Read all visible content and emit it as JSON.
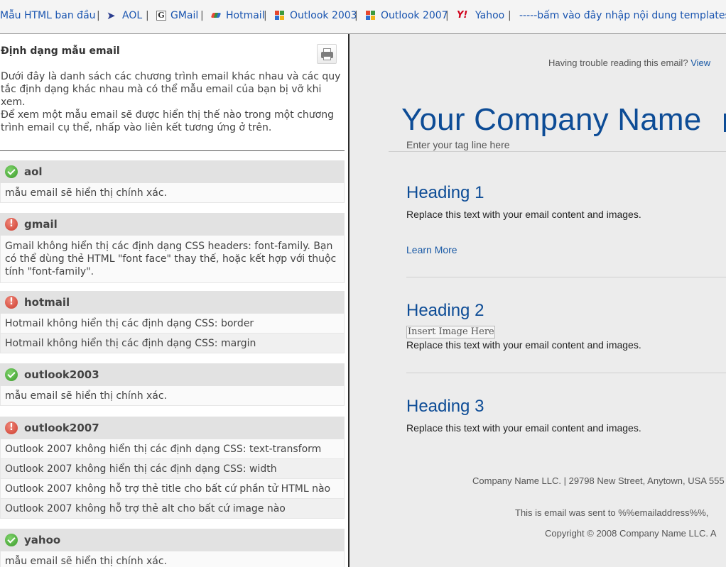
{
  "top_nav": {
    "items": [
      {
        "label": "Mẫu HTML ban đầu",
        "icon": null
      },
      {
        "label": "AOL",
        "icon": "aol-icon"
      },
      {
        "label": "GMail",
        "icon": "gmail-icon"
      },
      {
        "label": "Hotmail",
        "icon": "hotmail-icon"
      },
      {
        "label": "Outlook 2003",
        "icon": "outlook-2003-icon"
      },
      {
        "label": "Outlook 2007",
        "icon": "outlook-2007-icon"
      },
      {
        "label": "Yahoo",
        "icon": "yahoo-icon"
      },
      {
        "label": "-----bấm vào đây nhập nội dung templates n",
        "icon": null
      }
    ],
    "separator": "|"
  },
  "left_panel": {
    "title": "Định dạng mẫu email",
    "print_icon": "printer-icon",
    "description_1": "Dưới đây là danh sách các chương trình email khác nhau và các quy tắc định dạng khác nhau mà có thể mẫu email của bạn bị vỡ khi xem.",
    "description_2": "Để xem một mẫu email sẽ được hiển thị thế nào trong một chương trình email cụ thể, nhấp vào liên kết tương ứng ở trên.",
    "clients": [
      {
        "name": "aol",
        "status": "ok",
        "messages": [
          "mẫu email sẽ hiển thị chính xác."
        ]
      },
      {
        "name": "gmail",
        "status": "error",
        "messages": [
          "Gmail không hiển thị các định dạng CSS headers: font-family. Bạn có thể dùng thẻ HTML \"font face\" thay thế, hoặc kết hợp với thuộc tính \"font-family\"."
        ]
      },
      {
        "name": "hotmail",
        "status": "error",
        "messages": [
          "Hotmail không hiển thị các định dạng CSS: border",
          "Hotmail không hiển thị các định dạng CSS: margin"
        ]
      },
      {
        "name": "outlook2003",
        "status": "ok",
        "messages": [
          "mẫu email sẽ hiển thị chính xác."
        ]
      },
      {
        "name": "outlook2007",
        "status": "error",
        "messages": [
          "Outlook 2007 không hiển thị các định dạng CSS: text-transform",
          "Outlook 2007 không hiển thị các định dạng CSS: width",
          "Outlook 2007 không hỗ trợ thẻ title cho bất cứ phần tử HTML nào",
          "Outlook 2007 không hỗ trợ thẻ alt cho bất cứ image nào"
        ]
      },
      {
        "name": "yahoo",
        "status": "ok",
        "messages": [
          "mẫu email sẽ hiển thị chính xác."
        ]
      }
    ],
    "status_colors": {
      "ok": "#3a9a2a",
      "error": "#cc3b2c"
    }
  },
  "email_preview": {
    "trouble_text": "Having trouble reading this email?",
    "trouble_link": "View",
    "company_name": "Your Company Name",
    "tagline": "Enter your tag line here",
    "sections": [
      {
        "heading": "Heading 1",
        "body": "Replace this text with your email content and images.",
        "link": "Learn More"
      },
      {
        "heading": "Heading 2",
        "image_placeholder": "Insert Image Here",
        "body": "Replace this text with your email content and images."
      },
      {
        "heading": "Heading 3",
        "body": "Replace this text with your email content and images."
      }
    ],
    "footer": {
      "address": "Company Name LLC. | 29798 New Street, Anytown, USA 555",
      "sent_to": "This is email was sent to %%emailaddress%%, ",
      "copyright": "Copyright © 2008 Company Name LLC. A"
    },
    "brand_color": "#0d4c96"
  }
}
